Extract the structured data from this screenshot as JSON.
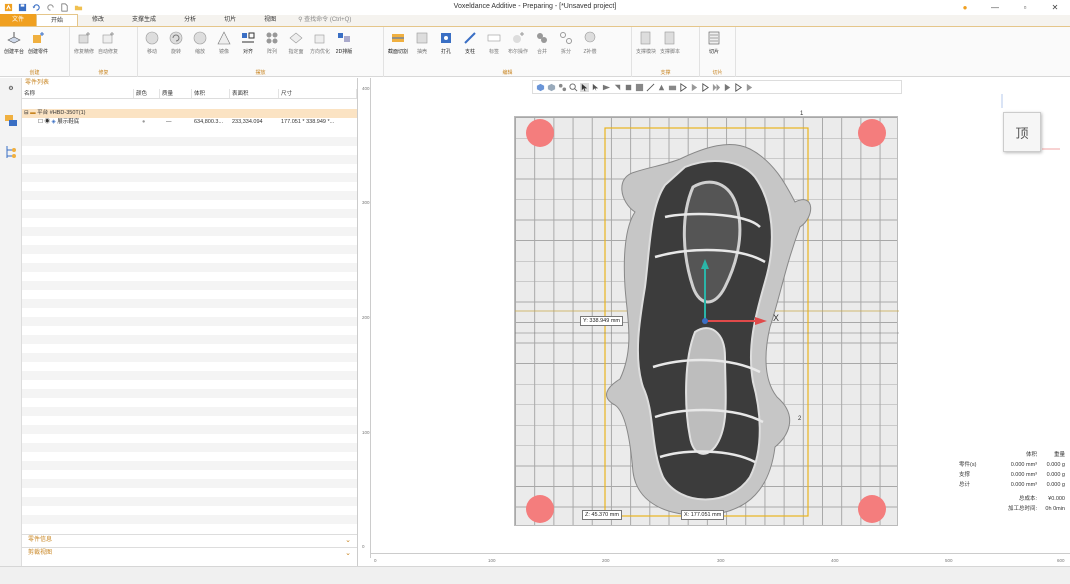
{
  "window": {
    "title": "Voxeldance Additive - Preparing - [*Unsaved project]"
  },
  "menu": {
    "file": "文件",
    "tabs": [
      "开始",
      "修改",
      "支撑生成",
      "分析",
      "切片",
      "视图"
    ],
    "search_placeholder": "查找命令 (Ctrl+Q)"
  },
  "ribbon": {
    "groups": [
      {
        "label": "创建",
        "buttons": [
          "创建平台",
          "创建零件"
        ]
      },
      {
        "label": "修复",
        "buttons": [
          "修复精修",
          "自动修复"
        ]
      },
      {
        "label": "摆放",
        "buttons": [
          "移动",
          "旋转",
          "缩放",
          "镜像",
          "对齐",
          "阵列",
          "指定面",
          "方向优化",
          "2D排版"
        ]
      },
      {
        "label": "编辑",
        "buttons": [
          "截面切割",
          "抽壳",
          "打孔",
          "支柱",
          "标签",
          "布尔操作",
          "合并",
          "拆分",
          "Z补偿"
        ]
      },
      {
        "label": "支撑",
        "buttons": [
          "支撑模块",
          "支撑脚本"
        ]
      },
      {
        "label": "切片",
        "buttons": [
          "切片"
        ]
      }
    ]
  },
  "panel": {
    "title": "零件列表",
    "columns": [
      "名称",
      "颜色",
      "质量",
      "体积",
      "表面积",
      "尺寸"
    ],
    "rows": [
      {
        "name": "平台 #HBD-350T(1)",
        "color": "",
        "mass": "",
        "volume": "",
        "area": "",
        "size": ""
      },
      {
        "name": "展示鞋底",
        "color": "●",
        "mass": "—",
        "volume": "634,800.3...",
        "area": "233,334.094",
        "size": "177.051 * 338.949 *..."
      }
    ],
    "sections": [
      "零件信息",
      "剪裁视图"
    ]
  },
  "viewport": {
    "viewcube_label": "顶",
    "dims": {
      "y": "Y: 338.949 mm",
      "z": "Z: 45.370 mm",
      "x": "X: 177.051 mm"
    },
    "axis_x": "X",
    "markers": [
      "1",
      "2"
    ],
    "ruler_left": [
      "400",
      "300",
      "200",
      "100",
      "0"
    ],
    "ruler_bottom": [
      "0",
      "100",
      "200",
      "300",
      "400",
      "500",
      "600"
    ]
  },
  "stats": {
    "headers": [
      "体积",
      "重量"
    ],
    "rows": [
      {
        "label": "零件(s)",
        "volume": "0.000 mm³",
        "weight": "0.000 g"
      },
      {
        "label": "支撑",
        "volume": "0.000 mm³",
        "weight": "0.000 g"
      },
      {
        "label": "总计",
        "volume": "0.000 mm³",
        "weight": "0.000 g"
      }
    ],
    "cost_label": "总成本:",
    "cost_value": "¥0.000",
    "time_label": "加工总时间:",
    "time_value": "0h 0min"
  },
  "colors": {
    "accent": "#f0a020",
    "plate": "#ebebeb",
    "corner": "#f47d7d",
    "build_box": "#e8b41e"
  }
}
